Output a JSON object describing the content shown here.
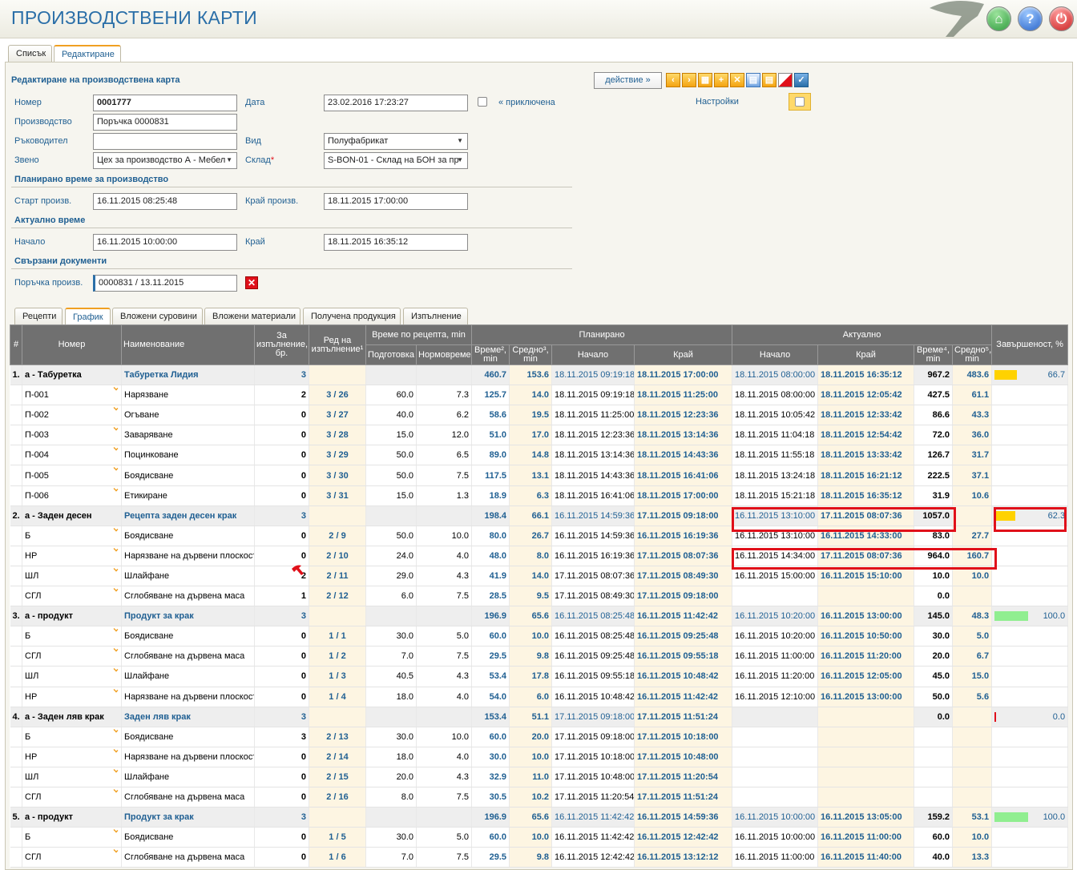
{
  "header": {
    "title": "ПРОИЗВОДСТВЕНИ КАРТИ"
  },
  "main_tabs": [
    "Списък",
    "Редактиране"
  ],
  "form": {
    "heading": "Редактиране на производствена карта",
    "action_button": "действие »",
    "number_label": "Номер",
    "number_value": "0001777",
    "date_label": "Дата",
    "date_value": "23.02.2016 17:23:27",
    "closed_label": "« приключена",
    "settings_label": "Настройки",
    "production_label": "Производство",
    "production_value": "Поръчка 0000831",
    "manager_label": "Ръководител",
    "manager_value": "",
    "kind_label": "Вид",
    "kind_value": "Полуфабрикат",
    "unit_label": "Звено",
    "unit_value": "Цех за производство А - Мебел",
    "warehouse_label": "Склад",
    "warehouse_value": "S-BON-01 - Склад на БОН за пр",
    "planned_section": "Планирано време за производство",
    "start_label": "Старт произв.",
    "start_value": "16.11.2015 08:25:48",
    "end_label": "Край произв.",
    "end_value": "18.11.2015 17:00:00",
    "actual_section": "Актуално време",
    "begin_label": "Начало",
    "begin_value": "16.11.2015 10:00:00",
    "finish_label": "Край",
    "finish_value": "18.11.2015 16:35:12",
    "docs_section": "Свързани документи",
    "order_label": "Поръчка произв.",
    "order_value": "0000831 / 13.11.2015"
  },
  "sub_tabs": [
    "Рецепти",
    "График",
    "Вложени суровини",
    "Вложени материали",
    "Получена продукция",
    "Изпълнение"
  ],
  "table_headers": {
    "num": "#",
    "code": "Номер",
    "name": "Наименование",
    "qty": "За изпълнение, бр.",
    "order": "Ред на изпълнение¹",
    "recipe_time": "Време по рецепта, min",
    "prep": "Подготовка",
    "norm": "Нормовреме",
    "planned": "Планирано",
    "actual": "Актуално",
    "time2": "Време², min",
    "avg3": "Средно³, min",
    "start": "Начало",
    "end": "Край",
    "astart": "Начало",
    "aend": "Край",
    "time4": "Време⁴, min",
    "avg5": "Средно⁵, min",
    "completion": "Завършеност, %"
  },
  "rows": [
    {
      "g": 1,
      "n": "1.",
      "code": "а - Табуретка",
      "name": "Табуретка Лидия",
      "qty": "3",
      "ord": "",
      "prep": "",
      "norm": "",
      "pt": "460.7",
      "pa": "153.6",
      "ps": "18.11.2015 09:19:18",
      "pe": "18.11.2015 17:00:00",
      "as": "18.11.2015 08:00:00",
      "ae": "18.11.2015 16:35:12",
      "at": "967.2",
      "aa": "483.6",
      "pct": "66.7",
      "pctv": 66.7,
      "color": "#ffd200"
    },
    {
      "n": "",
      "code": "П-001",
      "name": "Нарязване",
      "qty": "2",
      "ord": "3 / 26",
      "prep": "60.0",
      "norm": "7.3",
      "pt": "125.7",
      "pa": "14.0",
      "ps": "18.11.2015 09:19:18",
      "pe": "18.11.2015 11:25:00",
      "as": "18.11.2015 08:00:00",
      "ae": "18.11.2015 12:05:42",
      "at": "427.5",
      "aa": "61.1",
      "pct": ""
    },
    {
      "n": "",
      "code": "П-002",
      "name": "Огъване",
      "qty": "0",
      "ord": "3 / 27",
      "prep": "40.0",
      "norm": "6.2",
      "pt": "58.6",
      "pa": "19.5",
      "ps": "18.11.2015 11:25:00",
      "pe": "18.11.2015 12:23:36",
      "as": "18.11.2015 10:05:42",
      "ae": "18.11.2015 12:33:42",
      "at": "86.6",
      "aa": "43.3",
      "pct": ""
    },
    {
      "n": "",
      "code": "П-003",
      "name": "Заваряване",
      "qty": "0",
      "ord": "3 / 28",
      "prep": "15.0",
      "norm": "12.0",
      "pt": "51.0",
      "pa": "17.0",
      "ps": "18.11.2015 12:23:36",
      "pe": "18.11.2015 13:14:36",
      "as": "18.11.2015 11:04:18",
      "ae": "18.11.2015 12:54:42",
      "at": "72.0",
      "aa": "36.0",
      "pct": ""
    },
    {
      "n": "",
      "code": "П-004",
      "name": "Поцинковане",
      "qty": "0",
      "ord": "3 / 29",
      "prep": "50.0",
      "norm": "6.5",
      "pt": "89.0",
      "pa": "14.8",
      "ps": "18.11.2015 13:14:36",
      "pe": "18.11.2015 14:43:36",
      "as": "18.11.2015 11:55:18",
      "ae": "18.11.2015 13:33:42",
      "at": "126.7",
      "aa": "31.7",
      "pct": ""
    },
    {
      "n": "",
      "code": "П-005",
      "name": "Боядисване",
      "qty": "0",
      "ord": "3 / 30",
      "prep": "50.0",
      "norm": "7.5",
      "pt": "117.5",
      "pa": "13.1",
      "ps": "18.11.2015 14:43:36",
      "pe": "18.11.2015 16:41:06",
      "as": "18.11.2015 13:24:18",
      "ae": "18.11.2015 16:21:12",
      "at": "222.5",
      "aa": "37.1",
      "pct": ""
    },
    {
      "n": "",
      "code": "П-006",
      "name": "Етикиране",
      "qty": "0",
      "ord": "3 / 31",
      "prep": "15.0",
      "norm": "1.3",
      "pt": "18.9",
      "pa": "6.3",
      "ps": "18.11.2015 16:41:06",
      "pe": "18.11.2015 17:00:00",
      "as": "18.11.2015 15:21:18",
      "ae": "18.11.2015 16:35:12",
      "at": "31.9",
      "aa": "10.6",
      "pct": ""
    },
    {
      "g": 1,
      "n": "2.",
      "code": "а - Заден десен",
      "name": "Рецепта заден десен крак",
      "qty": "3",
      "ord": "",
      "prep": "",
      "norm": "",
      "pt": "198.4",
      "pa": "66.1",
      "ps": "16.11.2015 14:59:36",
      "pe": "17.11.2015 09:18:00",
      "as": "16.11.2015 13:10:00",
      "ae": "17.11.2015 08:07:36",
      "at": "1057.0",
      "aa": "",
      "pct": "62.3",
      "pctv": 62.3,
      "color": "#ffd200"
    },
    {
      "n": "",
      "code": "Б",
      "name": "Боядисване",
      "qty": "0",
      "ord": "2 / 9",
      "prep": "50.0",
      "norm": "10.0",
      "pt": "80.0",
      "pa": "26.7",
      "ps": "16.11.2015 14:59:36",
      "pe": "16.11.2015 16:19:36",
      "as": "16.11.2015 13:10:00",
      "ae": "16.11.2015 14:33:00",
      "at": "83.0",
      "aa": "27.7",
      "pct": ""
    },
    {
      "n": "",
      "code": "НР",
      "name": "Нарязване на дървени плоскости",
      "qty": "0",
      "ord": "2 / 10",
      "prep": "24.0",
      "norm": "4.0",
      "pt": "48.0",
      "pa": "8.0",
      "ps": "16.11.2015 16:19:36",
      "pe": "17.11.2015 08:07:36",
      "as": "16.11.2015 14:34:00",
      "ae": "17.11.2015 08:07:36",
      "at": "964.0",
      "aa": "160.7",
      "pct": ""
    },
    {
      "n": "",
      "code": "ШЛ",
      "name": "Шлайфане",
      "qty": "2",
      "ord": "2 / 11",
      "prep": "29.0",
      "norm": "4.3",
      "pt": "41.9",
      "pa": "14.0",
      "ps": "17.11.2015 08:07:36",
      "pe": "17.11.2015 08:49:30",
      "as": "16.11.2015 15:00:00",
      "ae": "16.11.2015 15:10:00",
      "at": "10.0",
      "aa": "10.0",
      "pct": ""
    },
    {
      "n": "",
      "code": "СГЛ",
      "name": "Сглобяване на дървена маса",
      "qty": "1",
      "ord": "2 / 12",
      "prep": "6.0",
      "norm": "7.5",
      "pt": "28.5",
      "pa": "9.5",
      "ps": "17.11.2015 08:49:30",
      "pe": "17.11.2015 09:18:00",
      "as": "",
      "ae": "",
      "at": "0.0",
      "aa": "",
      "pct": ""
    },
    {
      "g": 1,
      "n": "3.",
      "code": "а - продукт",
      "name": "Продукт за крак",
      "qty": "3",
      "ord": "",
      "prep": "",
      "norm": "",
      "pt": "196.9",
      "pa": "65.6",
      "ps": "16.11.2015 08:25:48",
      "pe": "16.11.2015 11:42:42",
      "as": "16.11.2015 10:20:00",
      "ae": "16.11.2015 13:00:00",
      "at": "145.0",
      "aa": "48.3",
      "pct": "100.0",
      "pctv": 100,
      "color": "#90ee90"
    },
    {
      "n": "",
      "code": "Б",
      "name": "Боядисване",
      "qty": "0",
      "ord": "1 / 1",
      "prep": "30.0",
      "norm": "5.0",
      "pt": "60.0",
      "pa": "10.0",
      "ps": "16.11.2015 08:25:48",
      "pe": "16.11.2015 09:25:48",
      "as": "16.11.2015 10:20:00",
      "ae": "16.11.2015 10:50:00",
      "at": "30.0",
      "aa": "5.0",
      "pct": ""
    },
    {
      "n": "",
      "code": "СГЛ",
      "name": "Сглобяване на дървена маса",
      "qty": "0",
      "ord": "1 / 2",
      "prep": "7.0",
      "norm": "7.5",
      "pt": "29.5",
      "pa": "9.8",
      "ps": "16.11.2015 09:25:48",
      "pe": "16.11.2015 09:55:18",
      "as": "16.11.2015 11:00:00",
      "ae": "16.11.2015 11:20:00",
      "at": "20.0",
      "aa": "6.7",
      "pct": ""
    },
    {
      "n": "",
      "code": "ШЛ",
      "name": "Шлайфане",
      "qty": "0",
      "ord": "1 / 3",
      "prep": "40.5",
      "norm": "4.3",
      "pt": "53.4",
      "pa": "17.8",
      "ps": "16.11.2015 09:55:18",
      "pe": "16.11.2015 10:48:42",
      "as": "16.11.2015 11:20:00",
      "ae": "16.11.2015 12:05:00",
      "at": "45.0",
      "aa": "15.0",
      "pct": ""
    },
    {
      "n": "",
      "code": "НР",
      "name": "Нарязване на дървени плоскости",
      "qty": "0",
      "ord": "1 / 4",
      "prep": "18.0",
      "norm": "4.0",
      "pt": "54.0",
      "pa": "6.0",
      "ps": "16.11.2015 10:48:42",
      "pe": "16.11.2015 11:42:42",
      "as": "16.11.2015 12:10:00",
      "ae": "16.11.2015 13:00:00",
      "at": "50.0",
      "aa": "5.6",
      "pct": ""
    },
    {
      "g": 1,
      "n": "4.",
      "code": "а - Заден ляв крак",
      "name": "Заден ляв крак",
      "qty": "3",
      "ord": "",
      "prep": "",
      "norm": "",
      "pt": "153.4",
      "pa": "51.1",
      "ps": "17.11.2015 09:18:00",
      "pe": "17.11.2015 11:51:24",
      "as": "",
      "ae": "",
      "at": "0.0",
      "aa": "",
      "pct": "0.0",
      "pctv": 0,
      "color": "#e0101a"
    },
    {
      "n": "",
      "code": "Б",
      "name": "Боядисване",
      "qty": "3",
      "ord": "2 / 13",
      "prep": "30.0",
      "norm": "10.0",
      "pt": "60.0",
      "pa": "20.0",
      "ps": "17.11.2015 09:18:00",
      "pe": "17.11.2015 10:18:00",
      "as": "",
      "ae": "",
      "at": "",
      "aa": "",
      "pct": ""
    },
    {
      "n": "",
      "code": "НР",
      "name": "Нарязване на дървени плоскости",
      "qty": "0",
      "ord": "2 / 14",
      "prep": "18.0",
      "norm": "4.0",
      "pt": "30.0",
      "pa": "10.0",
      "ps": "17.11.2015 10:18:00",
      "pe": "17.11.2015 10:48:00",
      "as": "",
      "ae": "",
      "at": "",
      "aa": "",
      "pct": ""
    },
    {
      "n": "",
      "code": "ШЛ",
      "name": "Шлайфане",
      "qty": "0",
      "ord": "2 / 15",
      "prep": "20.0",
      "norm": "4.3",
      "pt": "32.9",
      "pa": "11.0",
      "ps": "17.11.2015 10:48:00",
      "pe": "17.11.2015 11:20:54",
      "as": "",
      "ae": "",
      "at": "",
      "aa": "",
      "pct": ""
    },
    {
      "n": "",
      "code": "СГЛ",
      "name": "Сглобяване на дървена маса",
      "qty": "0",
      "ord": "2 / 16",
      "prep": "8.0",
      "norm": "7.5",
      "pt": "30.5",
      "pa": "10.2",
      "ps": "17.11.2015 11:20:54",
      "pe": "17.11.2015 11:51:24",
      "as": "",
      "ae": "",
      "at": "",
      "aa": "",
      "pct": ""
    },
    {
      "g": 1,
      "n": "5.",
      "code": "а - продукт",
      "name": "Продукт за крак",
      "qty": "3",
      "ord": "",
      "prep": "",
      "norm": "",
      "pt": "196.9",
      "pa": "65.6",
      "ps": "16.11.2015 11:42:42",
      "pe": "16.11.2015 14:59:36",
      "as": "16.11.2015 10:00:00",
      "ae": "16.11.2015 13:05:00",
      "at": "159.2",
      "aa": "53.1",
      "pct": "100.0",
      "pctv": 100,
      "color": "#90ee90"
    },
    {
      "n": "",
      "code": "Б",
      "name": "Боядисване",
      "qty": "0",
      "ord": "1 / 5",
      "prep": "30.0",
      "norm": "5.0",
      "pt": "60.0",
      "pa": "10.0",
      "ps": "16.11.2015 11:42:42",
      "pe": "16.11.2015 12:42:42",
      "as": "16.11.2015 10:00:00",
      "ae": "16.11.2015 11:00:00",
      "at": "60.0",
      "aa": "10.0",
      "pct": ""
    },
    {
      "n": "",
      "code": "СГЛ",
      "name": "Сглобяване на дървена маса",
      "qty": "0",
      "ord": "1 / 6",
      "prep": "7.0",
      "norm": "7.5",
      "pt": "29.5",
      "pa": "9.8",
      "ps": "16.11.2015 12:42:42",
      "pe": "16.11.2015 13:12:12",
      "as": "16.11.2015 11:00:00",
      "ae": "16.11.2015 11:40:00",
      "at": "40.0",
      "aa": "13.3",
      "pct": ""
    }
  ]
}
